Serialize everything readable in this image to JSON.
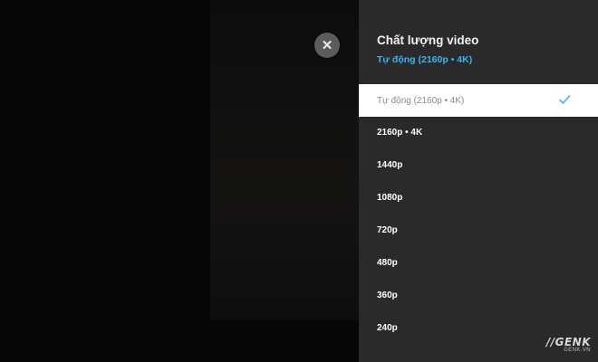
{
  "video": {
    "close_icon": "close-icon",
    "close_glyph": "✕"
  },
  "quality_panel": {
    "title": "Chất lượng video",
    "current": "Tự động (2160p • 4K)",
    "options": [
      {
        "label": "Tự động (2160p • 4K)",
        "selected": true
      },
      {
        "label": "2160p • 4K",
        "selected": false
      },
      {
        "label": "1440p",
        "selected": false
      },
      {
        "label": "1080p",
        "selected": false
      },
      {
        "label": "720p",
        "selected": false
      },
      {
        "label": "480p",
        "selected": false
      },
      {
        "label": "360p",
        "selected": false
      },
      {
        "label": "240p",
        "selected": false
      }
    ],
    "check_icon": "checkmark-icon"
  },
  "watermark": {
    "brand": "GENK",
    "site": "GENK.VN"
  },
  "colors": {
    "panel_bg": "#2a2a2a",
    "accent": "#3fb3f3",
    "selected_bg": "#ffffff",
    "selected_text": "#8b8b8b"
  }
}
